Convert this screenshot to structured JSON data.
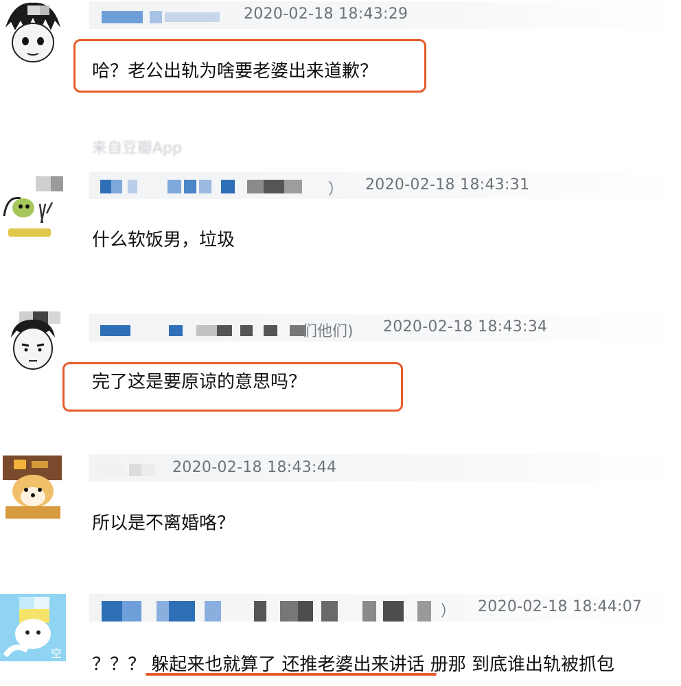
{
  "comments": [
    {
      "timestamp": "2020-02-18 18:43:29",
      "text": "哈？老公出轨为啥要老婆出来道歉？",
      "highlight": "box"
    },
    {
      "timestamp": "2020-02-18 18:43:31",
      "name_tail": "）",
      "text": "什么软饭男，垃圾",
      "highlight": "none"
    },
    {
      "timestamp": "2020-02-18 18:43:34",
      "name_tail": "们他们)",
      "text": "完了这是要原谅的意思吗？",
      "highlight": "box"
    },
    {
      "timestamp": "2020-02-18 18:43:44",
      "text": "所以是不离婚咯？",
      "highlight": "none"
    },
    {
      "timestamp": "2020-02-18 18:44:07",
      "name_tail": "）",
      "text": "？？？ 躲起来也就算了 还推老婆出来讲话 册那 到底谁出轨被抓包",
      "highlight": "underline"
    }
  ],
  "source_label": "来自豆瓣App",
  "colors": {
    "highlight": "#e65b2b",
    "timestamp": "#6d7278",
    "mosaic_blue": "#2f6fb8",
    "mosaic_gray": "#6b6b6b"
  }
}
